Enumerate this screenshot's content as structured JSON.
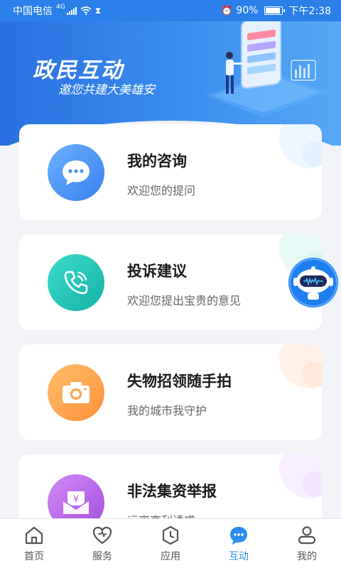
{
  "status_bar": {
    "carrier": "中国电信",
    "network": "4G",
    "battery": "90%",
    "time": "下午2:38"
  },
  "banner": {
    "title": "政民互动",
    "subtitle": "邀您共建大美雄安"
  },
  "cards": [
    {
      "title": "我的咨询",
      "subtitle": "欢迎您的提问",
      "icon": "chat-bubble-icon",
      "color": "#4a90f0"
    },
    {
      "title": "投诉建议",
      "subtitle": "欢迎您提出宝贵的意见",
      "icon": "phone-icon",
      "color": "#1cc3b8"
    },
    {
      "title": "失物招领随手拍",
      "subtitle": "我的城市我守护",
      "icon": "camera-icon",
      "color": "#ff9f45"
    },
    {
      "title": "非法集资举报",
      "subtitle": "远离高利诱惑",
      "icon": "yuan-envelope-icon",
      "color": "#b45de6"
    }
  ],
  "tabs": [
    {
      "label": "首页",
      "icon": "home-icon",
      "active": false
    },
    {
      "label": "服务",
      "icon": "heart-icon",
      "active": false
    },
    {
      "label": "应用",
      "icon": "clock-hexagon-icon",
      "active": false
    },
    {
      "label": "互动",
      "icon": "chat-icon",
      "active": true
    },
    {
      "label": "我的",
      "icon": "user-icon",
      "active": false
    }
  ],
  "colors": {
    "primary": "#2d8cf0",
    "banner_start": "#2a6fe0",
    "background": "#f2f3f7"
  }
}
